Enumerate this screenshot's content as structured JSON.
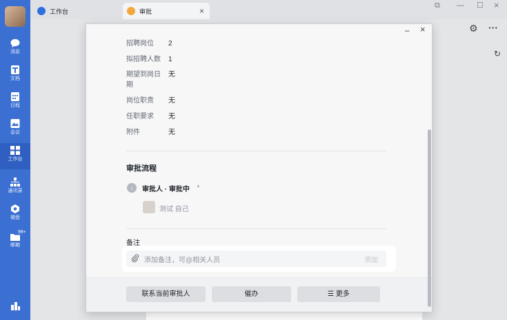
{
  "rail": {
    "items": [
      {
        "label": "消息",
        "icon": "chat-icon"
      },
      {
        "label": "文档",
        "icon": "doc-icon"
      },
      {
        "label": "日程",
        "icon": "calendar-icon"
      },
      {
        "label": "会议",
        "icon": "meeting-icon"
      },
      {
        "label": "工作台",
        "icon": "workbench-icon"
      },
      {
        "label": "通讯录",
        "icon": "contacts-icon"
      },
      {
        "label": "微盘",
        "icon": "drive-icon"
      },
      {
        "label": "邮箱",
        "icon": "mail-icon"
      }
    ],
    "mail_badge": "99+"
  },
  "tabs": [
    {
      "label": "工作台"
    },
    {
      "label": "审批"
    }
  ],
  "dialog": {
    "fields": [
      {
        "key": "招聘岗位",
        "value": "2"
      },
      {
        "key": "拟招聘人数",
        "value": "1"
      },
      {
        "key_line1": "期望到岗日",
        "key_line2": "期",
        "value": "无"
      },
      {
        "key": "岗位职责",
        "value": "无"
      },
      {
        "key": "任职要求",
        "value": "无"
      },
      {
        "key": "附件",
        "value": "无"
      }
    ],
    "flow_title": "审批流程",
    "flow_node": "审批人 · 审批中",
    "approver": "测试 自己",
    "remark_title": "备注",
    "remark_placeholder": "添加备注，可@相关人员",
    "remark_add": "添加",
    "buttons": {
      "contact": "联系当前审批人",
      "urge": "催办",
      "more": "☰ 更多"
    }
  },
  "colors": {
    "rail": "#3b6fd1",
    "tab_work_icon": "#2f6fe0",
    "tab_approval_icon": "#f2a93b"
  }
}
